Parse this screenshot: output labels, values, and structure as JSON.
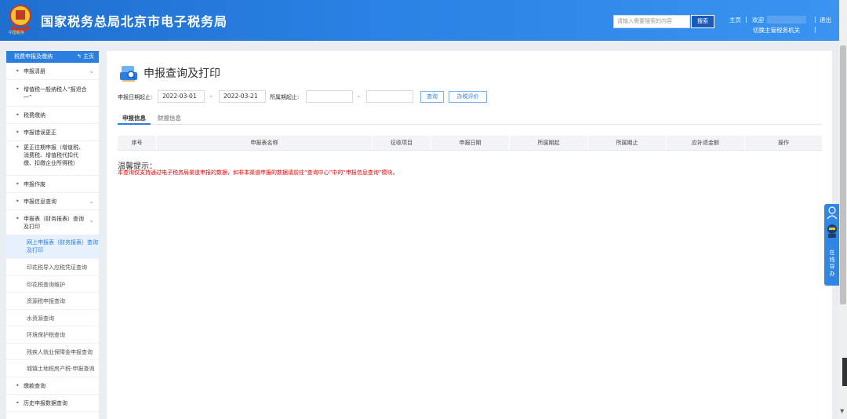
{
  "header": {
    "title": "国家税务总局北京市电子税务局",
    "emblem_text": "中国税务",
    "search_placeholder": "请输入需要搜索的内容",
    "search_button": "搜索",
    "home_link": "主页",
    "welcome": "欢迎",
    "logout": "退出",
    "switch_org": "切换主管税务机关"
  },
  "sidebar": {
    "header": "税费申报及缴纳",
    "home": "主页",
    "items": [
      {
        "label": "申报清册",
        "chevron": true
      },
      {
        "label": "增值税一般纳税人“报退合一”",
        "chevron": false
      },
      {
        "label": "税费缴纳",
        "chevron": false
      },
      {
        "label": "申报错误更正",
        "chevron": false
      },
      {
        "label": "更正往期申报（增值税、消费税、增值税代扣代缴、扣缴企业所得税）",
        "chevron": false
      },
      {
        "label": "申报作废",
        "chevron": false
      },
      {
        "label": "申报信息查询",
        "chevron": true
      },
      {
        "label": "申报表（财务报表）查询及打印",
        "chevron": true
      }
    ],
    "sub_items": [
      {
        "label": "网上申报表（财务报表）查询及打印",
        "active": true
      },
      {
        "label": "印花税导入应税凭证查询",
        "active": false
      },
      {
        "label": "印花税查询维护",
        "active": false
      },
      {
        "label": "资源税申报查询",
        "active": false
      },
      {
        "label": "水资源查询",
        "active": false
      },
      {
        "label": "环境保护税查询",
        "active": false
      },
      {
        "label": "残疾人就业保障金申报查询",
        "active": false
      },
      {
        "label": "城镇土地税房产税-申报查询",
        "active": false
      }
    ],
    "bottom_items": [
      {
        "label": "缴款查询"
      },
      {
        "label": "历史申报数据查询"
      }
    ]
  },
  "main": {
    "title": "申报查询及打印",
    "filters": {
      "date_label": "申报日期起止:",
      "date_from": "2022-03-01",
      "date_to": "2022-03-21",
      "period_label": "所属期起止:",
      "period_from": "",
      "period_to": "",
      "separator": "-"
    },
    "buttons": {
      "query": "查询",
      "evaluate": "办税评价"
    },
    "tabs": [
      {
        "label": "申报信息",
        "active": true
      },
      {
        "label": "财报信息",
        "active": false
      }
    ],
    "table_headers": [
      "序号",
      "申报表名称",
      "征收项目",
      "申报日期",
      "所属期起",
      "所属期止",
      "应补退金额",
      "操作"
    ],
    "tip_title": "温馨提示：",
    "tip_text": "本查询仅支持通过电子税务局渠道申报的数据，如非本渠道申报的数据请前往“查询中心”中的“申报信息查询”模块。"
  },
  "side_widget": {
    "label": "在线导办"
  },
  "colors": {
    "header_blue": "#2a82e4",
    "accent": "#2b7fe0",
    "tip_red": "#e00000"
  }
}
